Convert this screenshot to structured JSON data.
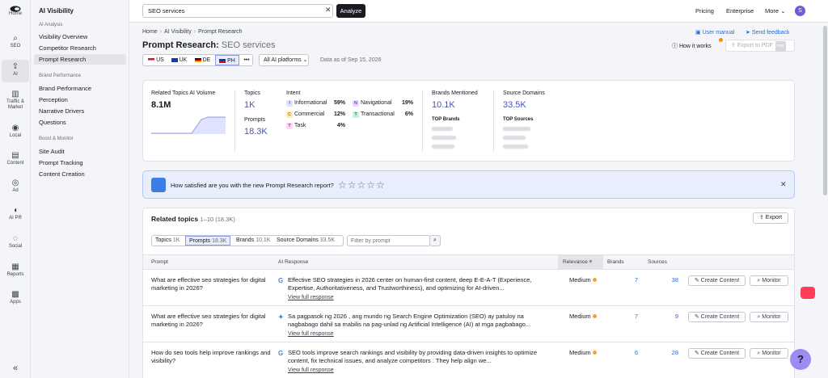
{
  "rail": {
    "items": [
      {
        "label": "Home",
        "icon": "home-icon"
      },
      {
        "label": "SEO",
        "icon": "seo-icon"
      },
      {
        "label": "AI",
        "icon": "ai-icon"
      },
      {
        "label": "Traffic &",
        "label2": "Market",
        "icon": "traffic-icon"
      },
      {
        "label": "Local",
        "icon": "local-icon"
      },
      {
        "label": "Content",
        "icon": "content-icon"
      },
      {
        "label": "Ad",
        "icon": "ad-icon"
      },
      {
        "label": "AI PR",
        "icon": "ai-pr-icon"
      },
      {
        "label": "Social",
        "icon": "social-icon"
      },
      {
        "label": "Reports",
        "icon": "reports-icon"
      },
      {
        "label": "Apps",
        "icon": "apps-icon"
      }
    ]
  },
  "subnav": {
    "title": "AI Visibility",
    "groups": [
      "AI Analysis",
      "Brand Performance",
      "Boost & Monitor"
    ],
    "items": [
      "Visibility Overview",
      "Competitor Research",
      "Prompt Research",
      "Brand Performance",
      "Perception",
      "Narrative Drivers",
      "Questions",
      "Site Audit",
      "Prompt Tracking",
      "Content Creation"
    ]
  },
  "topbar": {
    "search_value": "SEO services",
    "analyze": "Analyze",
    "pricing": "Pricing",
    "enterprise": "Enterprise",
    "more": "More",
    "avatar": "S"
  },
  "header": {
    "breadcrumb": [
      "Home",
      "AI Visibility",
      "Prompt Research"
    ],
    "title": "Prompt Research:",
    "keyword": "SEO services",
    "user_manual": "User manual",
    "send_feedback": "Send feedback",
    "how_it_works": "How it works",
    "export_pdf": "Export to PDF",
    "new_badge": "new"
  },
  "regions": [
    "US",
    "UK",
    "DE",
    "PH"
  ],
  "regions_more": "•••",
  "platforms": "All AI platforms",
  "data_as_of": "Data as of Sep 15, 2026",
  "stats": {
    "volume_label": "Related Topics AI Volume",
    "volume": "8.1M",
    "topics_label": "Topics",
    "topics": "1K",
    "prompts_label": "Prompts",
    "prompts": "18.3K",
    "intent_label": "Intent",
    "intents": [
      {
        "code": "I",
        "name": "Informational",
        "pct": "59%",
        "color": "#dfe3ff",
        "text": "#4a56b8"
      },
      {
        "code": "C",
        "name": "Commercial",
        "pct": "12%",
        "color": "#ffe8b3",
        "text": "#b07a00"
      },
      {
        "code": "T",
        "name": "Task",
        "pct": "4%",
        "color": "#ffd6f2",
        "text": "#b0307e"
      },
      {
        "code": "N",
        "name": "Navigational",
        "pct": "19%",
        "color": "#e9d9ff",
        "text": "#7b3fd1"
      },
      {
        "code": "T",
        "name": "Transactional",
        "pct": "6%",
        "color": "#c9f2e6",
        "text": "#1a8a66"
      }
    ],
    "brands_label": "Brands Mentioned",
    "brands": "10.1K",
    "top_brands": "TOP Brands",
    "domains_label": "Source Domains",
    "domains": "33.5K",
    "top_sources": "TOP Sources"
  },
  "banner": {
    "text": "How satisfied are you with the new Prompt Research report?",
    "stars": "☆☆☆☆☆"
  },
  "related": {
    "title": "Related topics",
    "count": "1–10 (18.3K)",
    "export": "Export",
    "tabs": [
      {
        "label": "Topics",
        "n": "1K"
      },
      {
        "label": "Prompts",
        "n": "18.3K"
      },
      {
        "label": "Brands",
        "n": "10.1K"
      },
      {
        "label": "Source Domains",
        "n": "33.5K"
      }
    ],
    "filter_placeholder": "Filter by prompt",
    "columns": [
      "Prompt",
      "AI Response",
      "Relevance",
      "Brands",
      "Sources"
    ],
    "rows": [
      {
        "prompt": "What are effective seo strategies for digital marketing in 2026?",
        "icon": "G",
        "icon_color": "#4285f4",
        "response": "Effective SEO strategies in 2026 center on human-first content, deep E-E-A-T (Experience, Expertise, Authoritativeness, and Trustworthiness), and optimizing for AI-driven...",
        "view": "View full response",
        "relevance": "Medium",
        "brands": "7",
        "sources": "38",
        "create": "Create Content",
        "monitor": "Monitor"
      },
      {
        "prompt": "What are effective seo strategies for digital marketing in 2026?",
        "icon": "✦",
        "icon_color": "#3d7de8",
        "response": "Sa pagpasok ng 2026 , ang mundo ng Search Engine Optimization (SEO) ay patuloy na nagbabago dahil sa mabilis na pag-unlad ng Artificial Intelligence (AI) at mga pagbabago...",
        "view": "View full response",
        "relevance": "Medium",
        "brands": "7",
        "sources": "9",
        "create": "Create Content",
        "monitor": "Monitor"
      },
      {
        "prompt": "How do seo tools help improve rankings and visibility?",
        "icon": "G",
        "icon_color": "#4285f4",
        "response": "SEO tools improve search rankings and visibility by providing data-driven insights to optimize content, fix technical issues, and analyze competitors . They help align we...",
        "view": "View full response",
        "relevance": "Medium",
        "brands": "6",
        "sources": "28",
        "create": "Create Content",
        "monitor": "Monitor"
      }
    ]
  }
}
